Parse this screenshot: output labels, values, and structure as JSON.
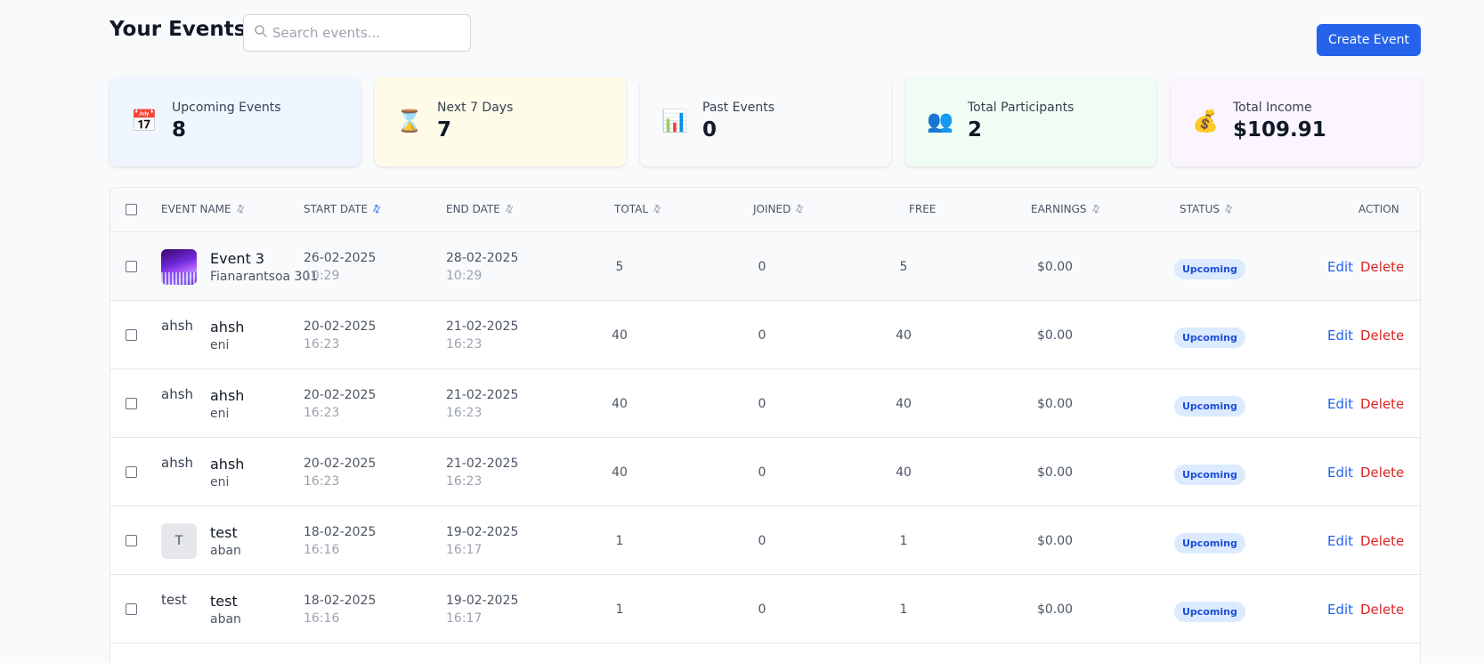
{
  "header": {
    "title": "Your Events",
    "search_placeholder": "Search events...",
    "create_label": "Create Event"
  },
  "stats": [
    {
      "icon": "📅",
      "icon_name": "calendar-icon",
      "label": "Upcoming Events",
      "value": "8",
      "bg": "#eff6ff"
    },
    {
      "icon": "⌛",
      "icon_name": "hourglass-icon",
      "label": "Next 7 Days",
      "value": "7",
      "bg": "#fefce8"
    },
    {
      "icon": "📊",
      "icon_name": "bar-chart-icon",
      "label": "Past Events",
      "value": "0",
      "bg": "#f9fafb"
    },
    {
      "icon": "👥",
      "icon_name": "people-icon",
      "label": "Total Participants",
      "value": "2",
      "bg": "#f0fdf4"
    },
    {
      "icon": "💰",
      "icon_name": "money-bag-icon",
      "label": "Total Income",
      "value": "$109.91",
      "bg": "#faf5ff"
    }
  ],
  "table": {
    "columns": [
      "EVENT NAME",
      "START DATE",
      "END DATE",
      "TOTAL",
      "JOINED",
      "FREE",
      "EARNINGS",
      "STATUS",
      "ACTION"
    ],
    "edit_label": "Edit",
    "delete_label": "Delete",
    "rows": [
      {
        "thumb": "image",
        "thumb_text": "",
        "name": "Event 3",
        "location": "Fianarantsoa 301",
        "start_date": "26-02-2025",
        "start_time": "10:29",
        "end_date": "28-02-2025",
        "end_time": "10:29",
        "total": "5",
        "joined": "0",
        "free": "5",
        "earnings": "$0.00",
        "status": "Upcoming"
      },
      {
        "thumb": "broken",
        "thumb_text": "ahsh",
        "name": "ahsh",
        "location": "eni",
        "start_date": "20-02-2025",
        "start_time": "16:23",
        "end_date": "21-02-2025",
        "end_time": "16:23",
        "total": "40",
        "joined": "0",
        "free": "40",
        "earnings": "$0.00",
        "status": "Upcoming"
      },
      {
        "thumb": "broken",
        "thumb_text": "ahsh",
        "name": "ahsh",
        "location": "eni",
        "start_date": "20-02-2025",
        "start_time": "16:23",
        "end_date": "21-02-2025",
        "end_time": "16:23",
        "total": "40",
        "joined": "0",
        "free": "40",
        "earnings": "$0.00",
        "status": "Upcoming"
      },
      {
        "thumb": "broken",
        "thumb_text": "ahsh",
        "name": "ahsh",
        "location": "eni",
        "start_date": "20-02-2025",
        "start_time": "16:23",
        "end_date": "21-02-2025",
        "end_time": "16:23",
        "total": "40",
        "joined": "0",
        "free": "40",
        "earnings": "$0.00",
        "status": "Upcoming"
      },
      {
        "thumb": "letter",
        "thumb_text": "T",
        "name": "test",
        "location": "aban",
        "start_date": "18-02-2025",
        "start_time": "16:16",
        "end_date": "19-02-2025",
        "end_time": "16:17",
        "total": "1",
        "joined": "0",
        "free": "1",
        "earnings": "$0.00",
        "status": "Upcoming"
      },
      {
        "thumb": "broken",
        "thumb_text": "test",
        "name": "test",
        "location": "aban",
        "start_date": "18-02-2025",
        "start_time": "16:16",
        "end_date": "19-02-2025",
        "end_time": "16:17",
        "total": "1",
        "joined": "0",
        "free": "1",
        "earnings": "$0.00",
        "status": "Upcoming"
      }
    ]
  }
}
